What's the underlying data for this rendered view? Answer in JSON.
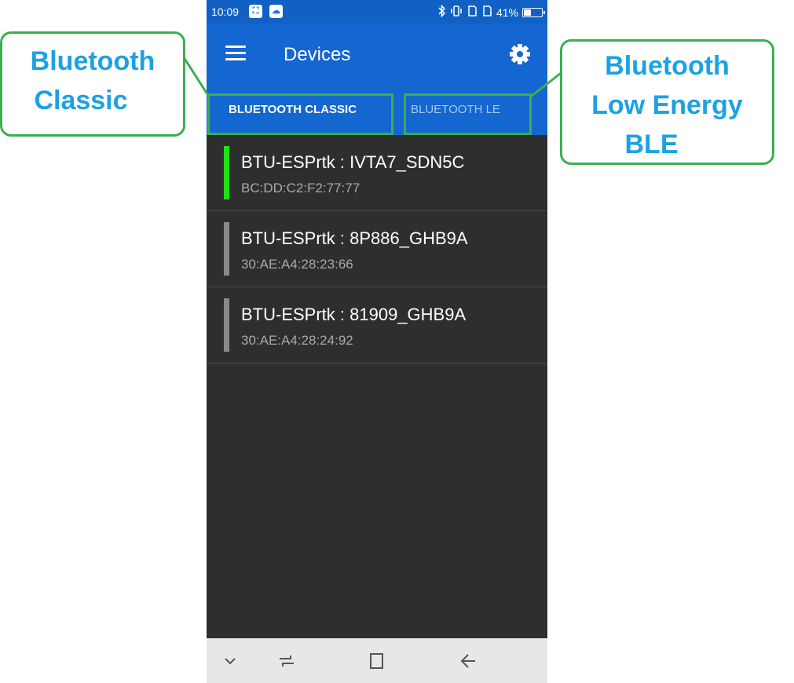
{
  "status_bar": {
    "time": "10:09",
    "battery_text": "41%",
    "battery_level": 0.41,
    "icons": [
      "screenshot-icon",
      "cloud-app-icon",
      "bluetooth-icon",
      "vibrate-icon",
      "signal-sim1-icon",
      "signal-sim2-icon",
      "battery-icon"
    ]
  },
  "app_bar": {
    "title": "Devices",
    "menu_icon": "hamburger-menu-icon",
    "settings_icon": "gear-icon"
  },
  "tabs": [
    {
      "label": "BLUETOOTH CLASSIC",
      "selected": true
    },
    {
      "label": "BLUETOOTH LE",
      "selected": false
    }
  ],
  "devices": [
    {
      "name": "BTU-ESPrtk : IVTA7_SDN5C",
      "address": "BC:DD:C2:F2:77:77",
      "indicator_color": "#22e014"
    },
    {
      "name": "BTU-ESPrtk : 8P886_GHB9A",
      "address": "30:AE:A4:28:23:66",
      "indicator_color": "#8a8a8a"
    },
    {
      "name": "BTU-ESPrtk : 81909_GHB9A",
      "address": "30:AE:A4:28:24:92",
      "indicator_color": "#8a8a8a"
    }
  ],
  "nav_bar": {
    "icons": [
      "chevron-down-icon",
      "recent-apps-icon",
      "home-icon",
      "back-icon"
    ]
  },
  "callouts": {
    "classic": {
      "line1": "Bluetooth",
      "line2": "Classic"
    },
    "ble": {
      "line1": "Bluetooth",
      "line2": "Low Energy",
      "line3": "BLE"
    }
  },
  "colors": {
    "accent": "#1466d0",
    "callout_border": "#3aaf50",
    "callout_text": "#1ca2e2",
    "list_background": "#2e2e2e"
  }
}
